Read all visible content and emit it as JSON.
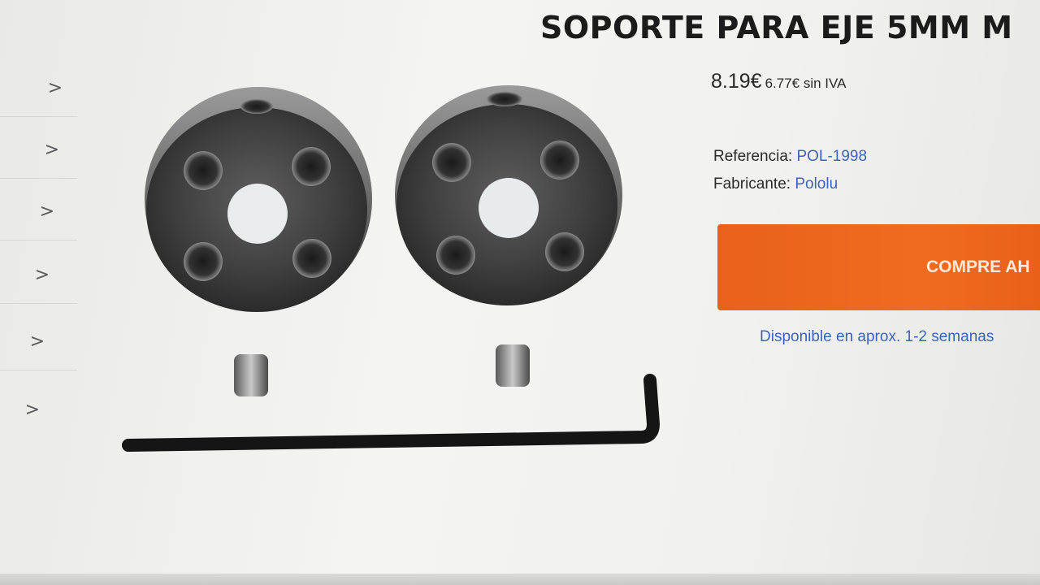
{
  "product": {
    "title": "SOPORTE PARA EJE 5MM M",
    "price": "8.19€",
    "price_net": "6.77€ sin IVA",
    "reference_label": "Referencia: ",
    "reference_value": "POL-1998",
    "manufacturer_label": "Fabricante: ",
    "manufacturer_value": "Pololu",
    "buy_label": "COMPRE AH",
    "availability": "Disponible en aprox. 1-2 semanas"
  },
  "sidebar": {
    "items": [
      ">",
      ">",
      ">",
      ">",
      ">",
      ">"
    ]
  },
  "colors": {
    "accent_orange": "#ef6a1f",
    "link_blue": "#3f63b6"
  },
  "icons": {
    "nav": "chevron-right-icon"
  }
}
